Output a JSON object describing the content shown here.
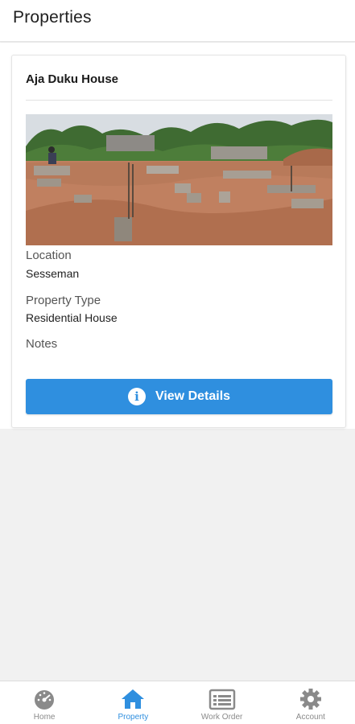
{
  "header": {
    "title": "Properties"
  },
  "property": {
    "name": "Aja Duku House",
    "location_label": "Location",
    "location_value": "Sesseman",
    "type_label": "Property Type",
    "type_value": "Residential House",
    "notes_label": "Notes",
    "notes_value": "",
    "view_button_label": "View Details"
  },
  "bottom_nav": {
    "items": [
      {
        "label": "Home",
        "icon": "dashboard-icon",
        "active": false
      },
      {
        "label": "Property",
        "icon": "home-icon",
        "active": true
      },
      {
        "label": "Work Order",
        "icon": "list-icon",
        "active": false
      },
      {
        "label": "Account",
        "icon": "gear-icon",
        "active": false
      }
    ]
  },
  "colors": {
    "accent": "#2f8fdf",
    "inactive_icon": "#8a8a8a",
    "background": "#f1f1f1"
  }
}
